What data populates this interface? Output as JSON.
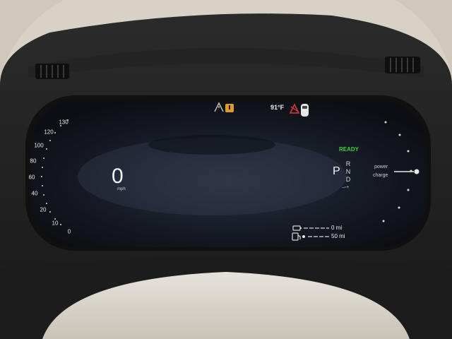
{
  "speedometer": {
    "speed_value": "0",
    "speed_unit": "mph",
    "tick_labels": [
      "130",
      "120",
      "100",
      "80",
      "60",
      "40",
      "20",
      "10",
      "0"
    ]
  },
  "top_bar": {
    "temperature": "91°F",
    "icons": [
      "road-edge-icon",
      "warning-icon",
      "collision-warning-icon",
      "car-icon"
    ]
  },
  "drive": {
    "status": "READY",
    "status_color": "#3ccf3c",
    "current_gear": "P",
    "gears": [
      "R",
      "N",
      "D"
    ]
  },
  "power_gauge": {
    "label_top": "power",
    "label_bottom": "charge"
  },
  "range": {
    "electric_range": "0 mi",
    "fuel_range": "50 mi"
  }
}
